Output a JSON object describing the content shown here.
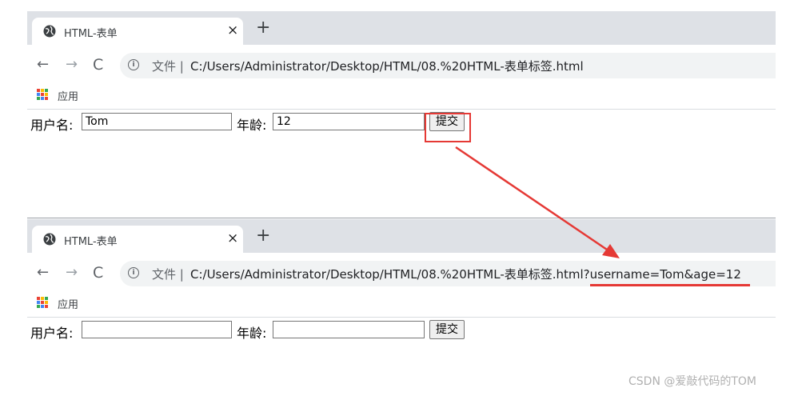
{
  "colors": {
    "annotation": "#e53935",
    "tabstrip": "#dee1e6",
    "omnibox": "#f1f3f4"
  },
  "before": {
    "tab": {
      "title": "HTML-表单",
      "close": "×",
      "new_tab": "+"
    },
    "toolbar": {
      "back": "←",
      "forward": "→",
      "reload": "C",
      "info_icon": "i",
      "scheme": "文件 |",
      "url": "C:/Users/Administrator/Desktop/HTML/08.%20HTML-表单标签.html"
    },
    "bookmarks": {
      "apps_label": "应用"
    },
    "form": {
      "username_label": "用户名:",
      "username_value": "Tom",
      "age_label": "年龄:",
      "age_value": "12",
      "submit_label": "提交"
    }
  },
  "after": {
    "tab": {
      "title": "HTML-表单",
      "close": "×",
      "new_tab": "+"
    },
    "toolbar": {
      "back": "←",
      "forward": "→",
      "reload": "C",
      "info_icon": "i",
      "scheme": "文件 |",
      "url": "C:/Users/Administrator/Desktop/HTML/08.%20HTML-表单标签.html?username=Tom&age=12"
    },
    "bookmarks": {
      "apps_label": "应用"
    },
    "form": {
      "username_label": "用户名:",
      "username_value": "",
      "age_label": "年龄:",
      "age_value": "",
      "submit_label": "提交"
    }
  },
  "watermark": "CSDN @爱敲代码的TOM"
}
